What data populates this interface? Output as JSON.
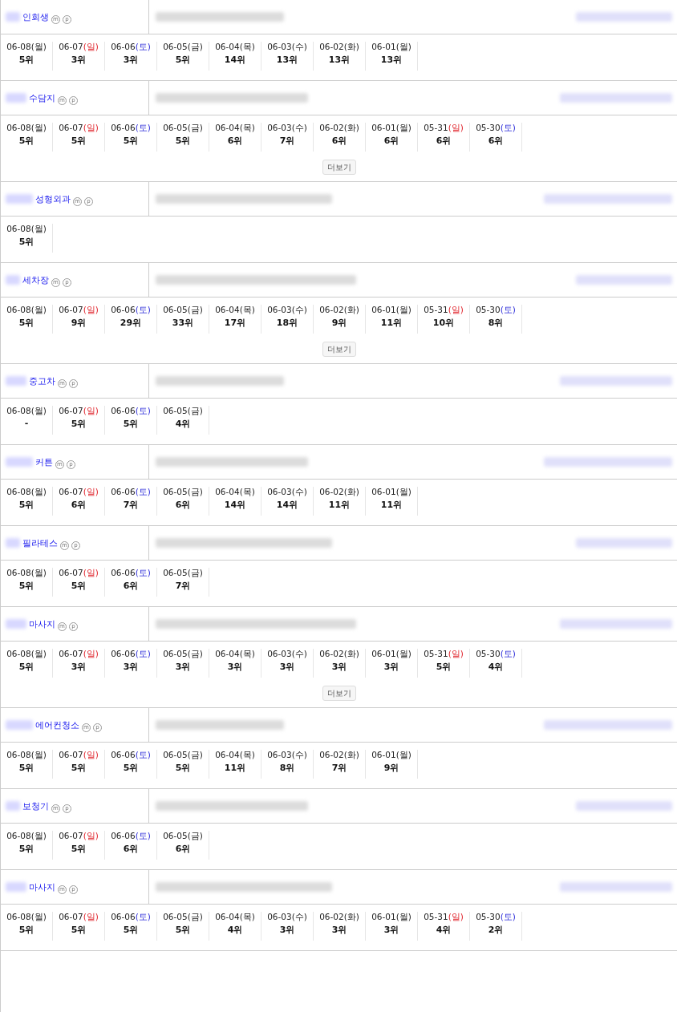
{
  "sections": [
    {
      "keyword": "인회생",
      "marks": [
        "m",
        "p"
      ],
      "ranks": [
        {
          "date": "06-08",
          "day": "(월)",
          "kind": "weekday",
          "rank": "5위"
        },
        {
          "date": "06-07",
          "day": "(일)",
          "kind": "sunday",
          "rank": "3위"
        },
        {
          "date": "06-06",
          "day": "(토)",
          "kind": "saturday",
          "rank": "3위"
        },
        {
          "date": "06-05",
          "day": "(금)",
          "kind": "weekday",
          "rank": "5위"
        },
        {
          "date": "06-04",
          "day": "(목)",
          "kind": "weekday",
          "rank": "14위"
        },
        {
          "date": "06-03",
          "day": "(수)",
          "kind": "weekday",
          "rank": "13위"
        },
        {
          "date": "06-02",
          "day": "(화)",
          "kind": "weekday",
          "rank": "13위"
        },
        {
          "date": "06-01",
          "day": "(월)",
          "kind": "weekday",
          "rank": "13위"
        }
      ]
    },
    {
      "keyword": "수담지",
      "marks": [
        "m",
        "p"
      ],
      "more_button": "더보기",
      "ranks": [
        {
          "date": "06-08",
          "day": "(월)",
          "kind": "weekday",
          "rank": "5위"
        },
        {
          "date": "06-07",
          "day": "(일)",
          "kind": "sunday",
          "rank": "5위"
        },
        {
          "date": "06-06",
          "day": "(토)",
          "kind": "saturday",
          "rank": "5위"
        },
        {
          "date": "06-05",
          "day": "(금)",
          "kind": "weekday",
          "rank": "5위"
        },
        {
          "date": "06-04",
          "day": "(목)",
          "kind": "weekday",
          "rank": "6위"
        },
        {
          "date": "06-03",
          "day": "(수)",
          "kind": "weekday",
          "rank": "7위"
        },
        {
          "date": "06-02",
          "day": "(화)",
          "kind": "weekday",
          "rank": "6위"
        },
        {
          "date": "06-01",
          "day": "(월)",
          "kind": "weekday",
          "rank": "6위"
        },
        {
          "date": "05-31",
          "day": "(일)",
          "kind": "sunday",
          "rank": "6위"
        },
        {
          "date": "05-30",
          "day": "(토)",
          "kind": "saturday",
          "rank": "6위"
        }
      ]
    },
    {
      "keyword": "성형외과",
      "marks": [
        "m",
        "p"
      ],
      "ranks": [
        {
          "date": "06-08",
          "day": "(월)",
          "kind": "weekday",
          "rank": "5위"
        }
      ]
    },
    {
      "keyword": "세차장",
      "marks": [
        "m",
        "p"
      ],
      "more_button": "더보기",
      "ranks": [
        {
          "date": "06-08",
          "day": "(월)",
          "kind": "weekday",
          "rank": "5위"
        },
        {
          "date": "06-07",
          "day": "(일)",
          "kind": "sunday",
          "rank": "9위"
        },
        {
          "date": "06-06",
          "day": "(토)",
          "kind": "saturday",
          "rank": "29위"
        },
        {
          "date": "06-05",
          "day": "(금)",
          "kind": "weekday",
          "rank": "33위"
        },
        {
          "date": "06-04",
          "day": "(목)",
          "kind": "weekday",
          "rank": "17위"
        },
        {
          "date": "06-03",
          "day": "(수)",
          "kind": "weekday",
          "rank": "18위"
        },
        {
          "date": "06-02",
          "day": "(화)",
          "kind": "weekday",
          "rank": "9위"
        },
        {
          "date": "06-01",
          "day": "(월)",
          "kind": "weekday",
          "rank": "11위"
        },
        {
          "date": "05-31",
          "day": "(일)",
          "kind": "sunday",
          "rank": "10위"
        },
        {
          "date": "05-30",
          "day": "(토)",
          "kind": "saturday",
          "rank": "8위"
        }
      ]
    },
    {
      "keyword": "중고차",
      "marks": [
        "m",
        "p"
      ],
      "ranks": [
        {
          "date": "06-08",
          "day": "(월)",
          "kind": "weekday",
          "rank": "-"
        },
        {
          "date": "06-07",
          "day": "(일)",
          "kind": "sunday",
          "rank": "5위"
        },
        {
          "date": "06-06",
          "day": "(토)",
          "kind": "saturday",
          "rank": "5위"
        },
        {
          "date": "06-05",
          "day": "(금)",
          "kind": "weekday",
          "rank": "4위"
        }
      ]
    },
    {
      "keyword": "커튼",
      "marks": [
        "m",
        "p"
      ],
      "ranks": [
        {
          "date": "06-08",
          "day": "(월)",
          "kind": "weekday",
          "rank": "5위"
        },
        {
          "date": "06-07",
          "day": "(일)",
          "kind": "sunday",
          "rank": "6위"
        },
        {
          "date": "06-06",
          "day": "(토)",
          "kind": "saturday",
          "rank": "7위"
        },
        {
          "date": "06-05",
          "day": "(금)",
          "kind": "weekday",
          "rank": "6위"
        },
        {
          "date": "06-04",
          "day": "(목)",
          "kind": "weekday",
          "rank": "14위"
        },
        {
          "date": "06-03",
          "day": "(수)",
          "kind": "weekday",
          "rank": "14위"
        },
        {
          "date": "06-02",
          "day": "(화)",
          "kind": "weekday",
          "rank": "11위"
        },
        {
          "date": "06-01",
          "day": "(월)",
          "kind": "weekday",
          "rank": "11위"
        }
      ]
    },
    {
      "keyword": "필라테스",
      "marks": [
        "m",
        "p"
      ],
      "ranks": [
        {
          "date": "06-08",
          "day": "(월)",
          "kind": "weekday",
          "rank": "5위"
        },
        {
          "date": "06-07",
          "day": "(일)",
          "kind": "sunday",
          "rank": "5위"
        },
        {
          "date": "06-06",
          "day": "(토)",
          "kind": "saturday",
          "rank": "6위"
        },
        {
          "date": "06-05",
          "day": "(금)",
          "kind": "weekday",
          "rank": "7위"
        }
      ]
    },
    {
      "keyword": "마사지",
      "marks": [
        "m",
        "p"
      ],
      "more_button": "더보기",
      "ranks": [
        {
          "date": "06-08",
          "day": "(월)",
          "kind": "weekday",
          "rank": "5위"
        },
        {
          "date": "06-07",
          "day": "(일)",
          "kind": "sunday",
          "rank": "3위"
        },
        {
          "date": "06-06",
          "day": "(토)",
          "kind": "saturday",
          "rank": "3위"
        },
        {
          "date": "06-05",
          "day": "(금)",
          "kind": "weekday",
          "rank": "3위"
        },
        {
          "date": "06-04",
          "day": "(목)",
          "kind": "weekday",
          "rank": "3위"
        },
        {
          "date": "06-03",
          "day": "(수)",
          "kind": "weekday",
          "rank": "3위"
        },
        {
          "date": "06-02",
          "day": "(화)",
          "kind": "weekday",
          "rank": "3위"
        },
        {
          "date": "06-01",
          "day": "(월)",
          "kind": "weekday",
          "rank": "3위"
        },
        {
          "date": "05-31",
          "day": "(일)",
          "kind": "sunday",
          "rank": "5위"
        },
        {
          "date": "05-30",
          "day": "(토)",
          "kind": "saturday",
          "rank": "4위"
        }
      ]
    },
    {
      "keyword": "에어컨청소",
      "marks": [
        "m",
        "p"
      ],
      "ranks": [
        {
          "date": "06-08",
          "day": "(월)",
          "kind": "weekday",
          "rank": "5위"
        },
        {
          "date": "06-07",
          "day": "(일)",
          "kind": "sunday",
          "rank": "5위"
        },
        {
          "date": "06-06",
          "day": "(토)",
          "kind": "saturday",
          "rank": "5위"
        },
        {
          "date": "06-05",
          "day": "(금)",
          "kind": "weekday",
          "rank": "5위"
        },
        {
          "date": "06-04",
          "day": "(목)",
          "kind": "weekday",
          "rank": "11위"
        },
        {
          "date": "06-03",
          "day": "(수)",
          "kind": "weekday",
          "rank": "8위"
        },
        {
          "date": "06-02",
          "day": "(화)",
          "kind": "weekday",
          "rank": "7위"
        },
        {
          "date": "06-01",
          "day": "(월)",
          "kind": "weekday",
          "rank": "9위"
        }
      ]
    },
    {
      "keyword": "보청기",
      "marks": [
        "m",
        "p"
      ],
      "ranks": [
        {
          "date": "06-08",
          "day": "(월)",
          "kind": "weekday",
          "rank": "5위"
        },
        {
          "date": "06-07",
          "day": "(일)",
          "kind": "sunday",
          "rank": "5위"
        },
        {
          "date": "06-06",
          "day": "(토)",
          "kind": "saturday",
          "rank": "6위"
        },
        {
          "date": "06-05",
          "day": "(금)",
          "kind": "weekday",
          "rank": "6위"
        }
      ]
    },
    {
      "keyword": "마사지",
      "marks": [
        "m",
        "p"
      ],
      "ranks": [
        {
          "date": "06-08",
          "day": "(월)",
          "kind": "weekday",
          "rank": "5위"
        },
        {
          "date": "06-07",
          "day": "(일)",
          "kind": "sunday",
          "rank": "5위"
        },
        {
          "date": "06-06",
          "day": "(토)",
          "kind": "saturday",
          "rank": "5위"
        },
        {
          "date": "06-05",
          "day": "(금)",
          "kind": "weekday",
          "rank": "5위"
        },
        {
          "date": "06-04",
          "day": "(목)",
          "kind": "weekday",
          "rank": "4위"
        },
        {
          "date": "06-03",
          "day": "(수)",
          "kind": "weekday",
          "rank": "3위"
        },
        {
          "date": "06-02",
          "day": "(화)",
          "kind": "weekday",
          "rank": "3위"
        },
        {
          "date": "06-01",
          "day": "(월)",
          "kind": "weekday",
          "rank": "3위"
        },
        {
          "date": "05-31",
          "day": "(일)",
          "kind": "sunday",
          "rank": "4위"
        },
        {
          "date": "05-30",
          "day": "(토)",
          "kind": "saturday",
          "rank": "2위"
        }
      ]
    }
  ]
}
